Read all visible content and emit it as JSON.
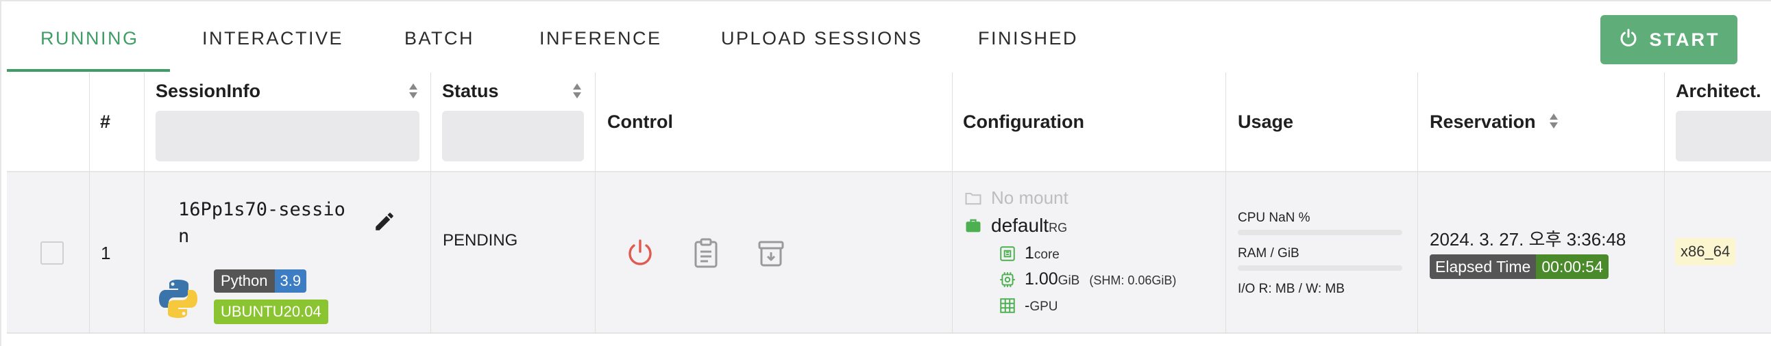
{
  "tabs": [
    {
      "label": "RUNNING",
      "active": true
    },
    {
      "label": "INTERACTIVE",
      "active": false
    },
    {
      "label": "BATCH",
      "active": false
    },
    {
      "label": "INFERENCE",
      "active": false
    },
    {
      "label": "UPLOAD SESSIONS",
      "active": false
    },
    {
      "label": "FINISHED",
      "active": false
    }
  ],
  "start_button": {
    "label": "START",
    "icon": "power-icon",
    "color": "#5fae79"
  },
  "accent_color": "#3e9e66",
  "columns": {
    "index": "#",
    "session_info": "SessionInfo",
    "status": "Status",
    "control": "Control",
    "configuration": "Configuration",
    "usage": "Usage",
    "reservation": "Reservation",
    "architecture": "Architect."
  },
  "row": {
    "index": "1",
    "session_name_line1": "16Pp1s70-sessio",
    "session_name_line2": "n",
    "lang_badge": {
      "name": "Python",
      "version": "3.9"
    },
    "os_badge": "UBUNTU20.04",
    "status": "PENDING",
    "config": {
      "mount": "No mount",
      "resource_group": "default",
      "resource_group_suffix": "RG",
      "cpu_value": "1",
      "cpu_unit": "core",
      "mem_value": "1.00",
      "mem_unit": "GiB",
      "shm": "(SHM: 0.06GiB)",
      "gpu_value": "-",
      "gpu_unit": "GPU"
    },
    "usage": {
      "cpu": "CPU NaN %",
      "ram": "RAM / GiB",
      "io": "I/O  R: MB / W: MB"
    },
    "reservation": {
      "datetime": "2024. 3. 27. 오후 3:36:48",
      "elapsed_label": "Elapsed Time",
      "elapsed_value": "00:00:54"
    },
    "architecture": "x86_64"
  }
}
